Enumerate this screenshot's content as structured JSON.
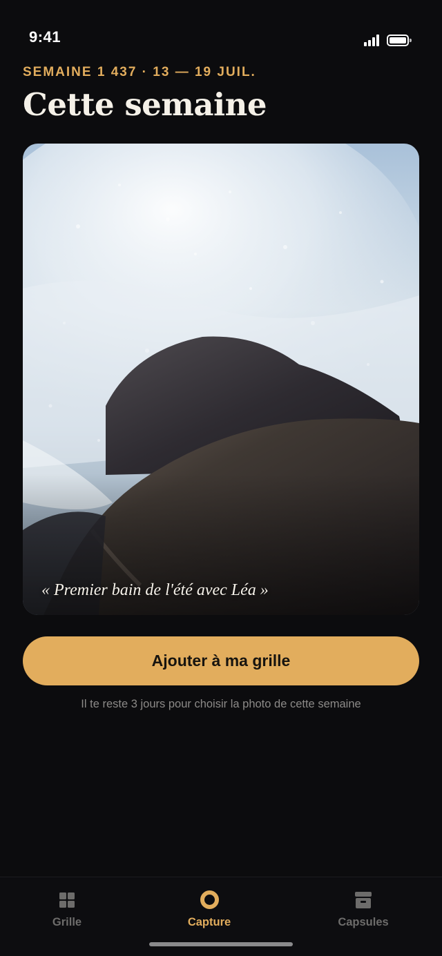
{
  "status_bar": {
    "time": "9:41"
  },
  "header": {
    "week_label": "SEMAINE 1 437 · 13 — 19 JUIL.",
    "title": "Cette semaine"
  },
  "photo": {
    "caption": "« Premier bain de l'été avec Léa »",
    "subject": "wave crashing on rocks"
  },
  "actions": {
    "add_button_label": "Ajouter à ma grille",
    "helper_text": "Il te reste 3 jours pour choisir la photo de cette semaine"
  },
  "tab_bar": {
    "tabs": [
      {
        "label": "Grille",
        "icon": "grid-icon",
        "active": false
      },
      {
        "label": "Capture",
        "icon": "capture-icon",
        "active": true
      },
      {
        "label": "Capsules",
        "icon": "archive-icon",
        "active": false
      }
    ]
  },
  "colors": {
    "background": "#0c0c0e",
    "accent": "#e2ad5d",
    "inactive": "#6d6c6b",
    "text": "#f5f1e8"
  }
}
